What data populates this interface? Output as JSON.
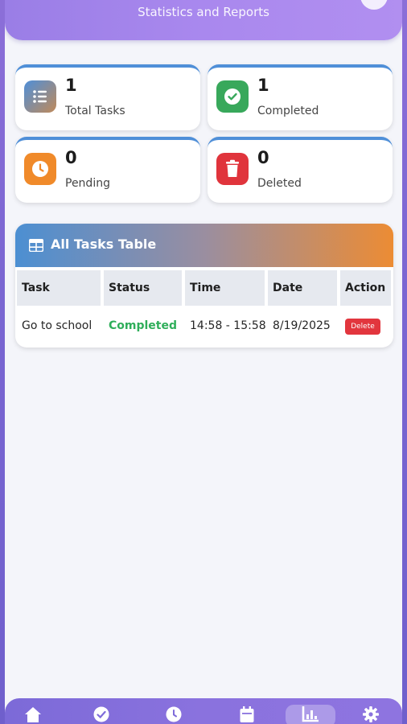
{
  "header": {
    "subtitle": "Statistics and Reports"
  },
  "stats": [
    {
      "value": "1",
      "label": "Total Tasks",
      "color": "#7d7fa6",
      "icon": "list-icon"
    },
    {
      "value": "1",
      "label": "Completed",
      "color": "#38a85b",
      "icon": "check-circle-icon"
    },
    {
      "value": "0",
      "label": "Pending",
      "color": "#f08a2a",
      "icon": "clock-icon"
    },
    {
      "value": "0",
      "label": "Deleted",
      "color": "#e0343c",
      "icon": "trash-icon"
    }
  ],
  "table": {
    "title": "All Tasks Table",
    "columns": [
      "Task",
      "Status",
      "Time",
      "Date",
      "Action"
    ],
    "rows": [
      {
        "task": "Go to school",
        "status": "Completed",
        "time": "14:58 - 15:58",
        "date": "8/19/2025",
        "action": "Delete"
      }
    ]
  },
  "nav": {
    "items": [
      "home-icon",
      "check-icon",
      "clock-icon",
      "calendar-icon",
      "chart-icon",
      "gear-icon"
    ],
    "active_index": 4
  }
}
